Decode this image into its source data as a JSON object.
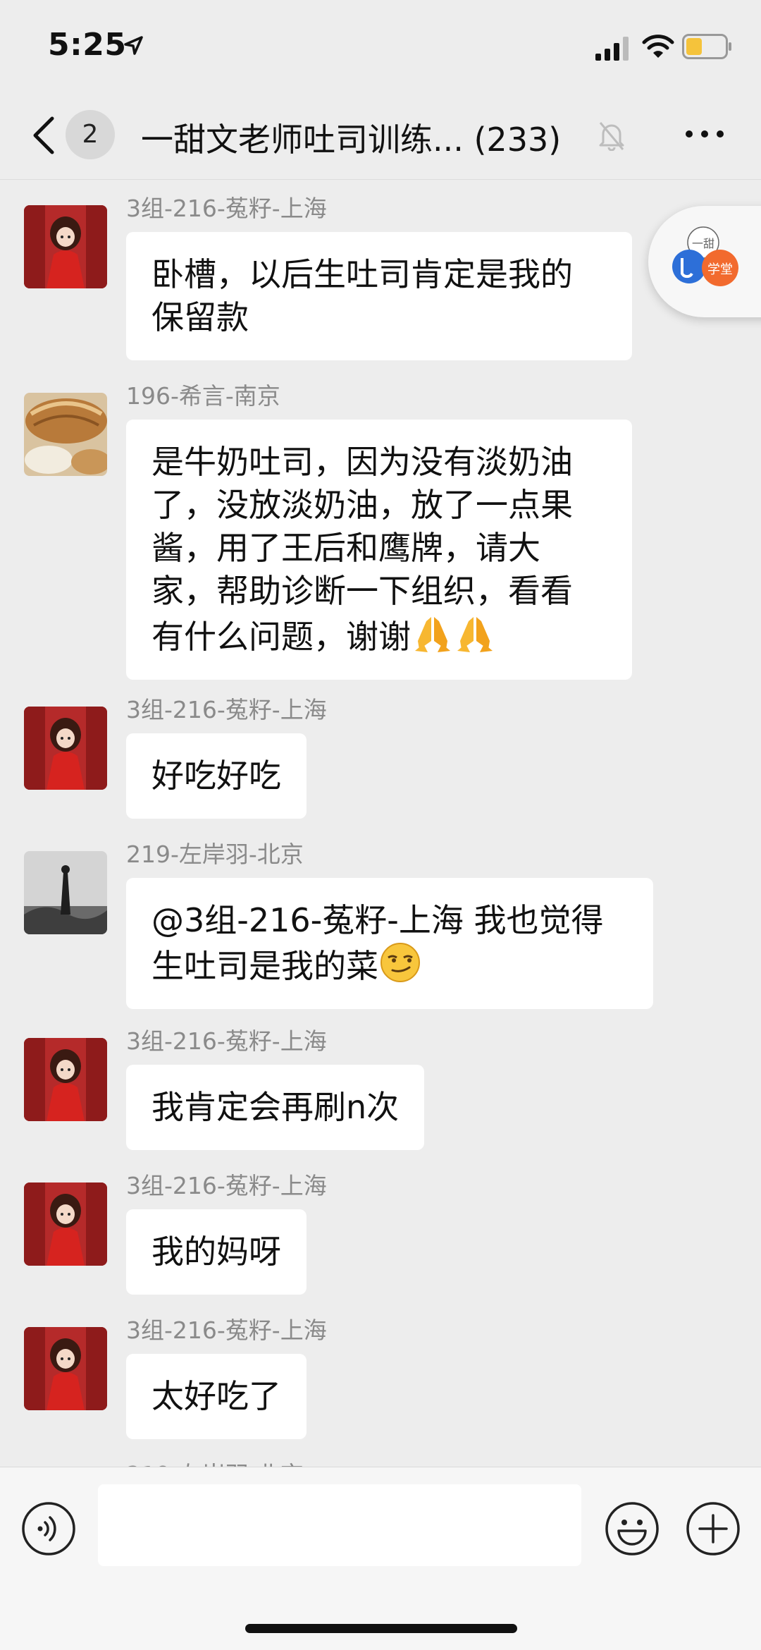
{
  "status_bar": {
    "time": "5:25"
  },
  "header": {
    "unread_count": "2",
    "title": "一甜文老师吐司训练... (233)"
  },
  "messages": [
    {
      "sender": "3组-216-菟籽-上海",
      "text": "卧槽，以后生吐司肯定是我的\n保留款",
      "avatar": "girl-in-red-avatar"
    },
    {
      "sender": "196-希言-南京",
      "text": "是牛奶吐司，因为没有淡奶油\n了，没放淡奶油，放了一点果\n酱，用了王后和鹰牌，请大\n家，帮助诊断一下组织，看看\n有什么问题，谢谢",
      "emojis": [
        "folded-hands",
        "folded-hands"
      ],
      "avatar": "bread-photo-avatar"
    },
    {
      "sender": "3组-216-菟籽-上海",
      "text": "好吃好吃",
      "avatar": "girl-in-red-avatar"
    },
    {
      "sender": "219-左岸羽-北京",
      "text": "@3组-216-菟籽-上海 我也觉得\n生吐司是我的菜",
      "emojis": [
        "smirk-face"
      ],
      "avatar": "bw-photo-avatar"
    },
    {
      "sender": "3组-216-菟籽-上海",
      "text": "我肯定会再刷n次",
      "avatar": "girl-in-red-avatar"
    },
    {
      "sender": "3组-216-菟籽-上海",
      "text": "我的妈呀",
      "avatar": "girl-in-red-avatar"
    },
    {
      "sender": "3组-216-菟籽-上海",
      "text": "太好吃了",
      "avatar": "girl-in-red-avatar"
    },
    {
      "sender": "219-左岸羽-北京",
      "text": "",
      "avatar": "bw-photo-avatar"
    }
  ],
  "floating_widget": {
    "logo_line1": "一甜",
    "logo_line2": "学堂"
  },
  "input": {
    "value": ""
  },
  "colors": {
    "background": "#ededed",
    "bubble": "#ffffff",
    "sender_name": "#8a8a8a",
    "battery_fill": "#f5c33b"
  }
}
